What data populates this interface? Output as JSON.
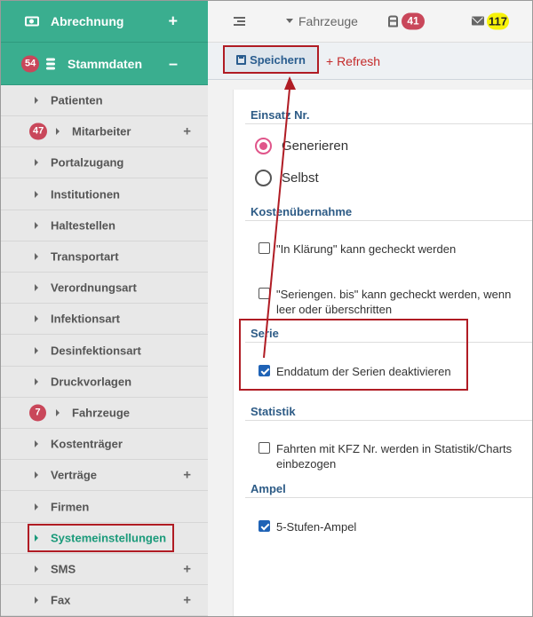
{
  "sidebar": {
    "abrechnung": {
      "label": "Abrechnung",
      "icon": "money-icon",
      "action": "+"
    },
    "stammdaten": {
      "label": "Stammdaten",
      "badge": "54",
      "icon": "database-icon",
      "action": "–"
    },
    "items": [
      {
        "label": "Patienten"
      },
      {
        "label": "Mitarbeiter",
        "badge": "47",
        "plus": "+"
      },
      {
        "label": "Portalzugang"
      },
      {
        "label": "Institutionen"
      },
      {
        "label": "Haltestellen"
      },
      {
        "label": "Transportart"
      },
      {
        "label": "Verordnungsart"
      },
      {
        "label": "Infektionsart"
      },
      {
        "label": "Desinfektionsart"
      },
      {
        "label": "Druckvorlagen"
      },
      {
        "label": "Fahrzeuge",
        "badge": "7"
      },
      {
        "label": "Kostenträger"
      },
      {
        "label": "Verträge",
        "plus": "+"
      },
      {
        "label": "Firmen"
      },
      {
        "label": "Systemeinstellungen",
        "active": true
      },
      {
        "label": "SMS",
        "plus": "+"
      },
      {
        "label": "Fax",
        "plus": "+"
      }
    ]
  },
  "topbar": {
    "menu_icon": "list-icon",
    "fahrzeuge": "Fahrzeuge",
    "bus_count": "41",
    "mail_count": "117"
  },
  "actionbar": {
    "save_label": "Speichern",
    "refresh_label": "+ Refresh"
  },
  "panel": {
    "einsatz": {
      "title": "Einsatz Nr.",
      "options": [
        {
          "label": "Generieren",
          "checked": true
        },
        {
          "label": "Selbst",
          "checked": false
        }
      ]
    },
    "kosten": {
      "title": "Kostenübernahme",
      "options": [
        {
          "label": "\"In Klärung\" kann gecheckt werden",
          "checked": false
        },
        {
          "label": "\"Seriengen. bis\" kann gecheckt werden, wenn leer oder überschritten",
          "checked": false
        }
      ]
    },
    "serie": {
      "title": "Serie",
      "options": [
        {
          "label": "Enddatum der Serien deaktivieren",
          "checked": true
        }
      ]
    },
    "statistik": {
      "title": "Statistik",
      "options": [
        {
          "label": "Fahrten mit KFZ Nr. werden in Statistik/Charts einbezogen",
          "checked": false
        }
      ]
    },
    "ampel": {
      "title": "Ampel",
      "options": [
        {
          "label": "5-Stufen-Ampel",
          "checked": true
        }
      ]
    }
  },
  "colors": {
    "sidebar_green": "#3aae8f",
    "active_item": "#1a9a7a",
    "section_title": "#2d5b86",
    "badge_red": "#c9475a",
    "badge_yellow": "#f7f20a",
    "annotation_red": "#b01c24",
    "radio_pink": "#e0558a",
    "checkbox_blue": "#1f63b6"
  }
}
